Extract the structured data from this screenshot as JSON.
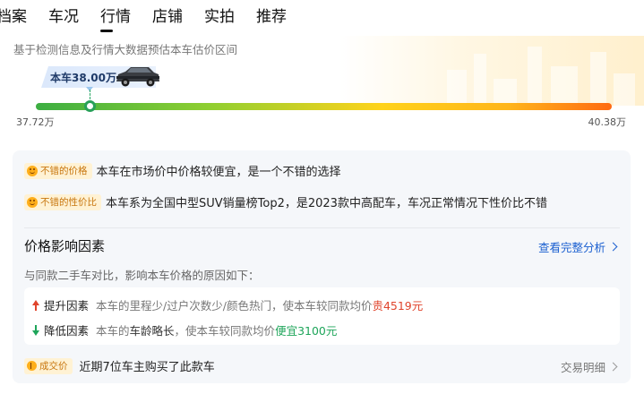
{
  "tabs": [
    {
      "label": "档案"
    },
    {
      "label": "车况"
    },
    {
      "label": "行情"
    },
    {
      "label": "店铺"
    },
    {
      "label": "实拍"
    },
    {
      "label": "推荐"
    }
  ],
  "estimate": {
    "description": "基于检测信息及行情大数据预估本车估价区间",
    "car_price_label": "本车38.00万",
    "range_min": "37.72万",
    "range_max": "40.38万",
    "car_position_fraction": 0.1
  },
  "tips": [
    {
      "badge": "不错的价格",
      "text": "本车在市场价中价格较便宜，是一个不错的选择"
    },
    {
      "badge": "不错的性价比",
      "text": "本车系为全国中型SUV销量榜Top2，是2023款中高配车，车况正常情况下性价比不错"
    }
  ],
  "factors": {
    "title": "价格影响因素",
    "link": "查看完整分析",
    "description": "与同款二手车对比，影响本车价格的原因如下：",
    "increase": {
      "type": "提升因素",
      "pre": "本车的里程少/过户次数少/颜色热门，使本车较同款均价",
      "highlight": "贵4519元"
    },
    "decrease": {
      "type": "降低因素",
      "pre": "本车的",
      "strong": "车龄略长",
      "mid": "，使本车较同款均价",
      "highlight": "便宜3100元"
    }
  },
  "deal": {
    "badge": "成交价",
    "text": "近期7位车主购买了此款车",
    "link": "交易明细"
  },
  "colors": {
    "accent_blue": "#1a5fd0",
    "up_red": "#e0442c",
    "down_green": "#1ea55a",
    "badge_orange": "#c8760e"
  }
}
